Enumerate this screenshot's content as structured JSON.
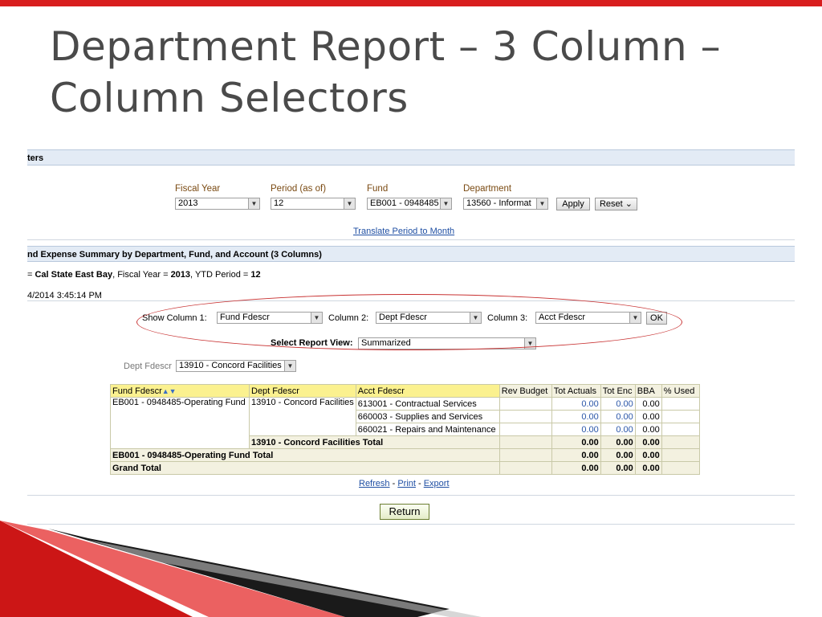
{
  "slide": {
    "title_line1": "Department Report – 3 Column –",
    "title_line2": "Column Selectors"
  },
  "filters": {
    "header": "ters",
    "fiscal_year_label": "Fiscal Year",
    "fiscal_year_value": "2013",
    "period_label": "Period (as of)",
    "period_value": "12",
    "fund_label": "Fund",
    "fund_value": "EB001 - 0948485",
    "department_label": "Department",
    "department_value": "13560 - Informat",
    "apply": "Apply",
    "reset": "Reset",
    "translate_link": "Translate Period to Month"
  },
  "report": {
    "header": "nd Expense Summary by Department, Fund, and Account (3 Columns)",
    "line1_prefix": "= ",
    "campus": "Cal State East Bay",
    "fy_label": ", Fiscal Year = ",
    "fy": "2013",
    "ytd_label": ", YTD Period = ",
    "ytd": "12",
    "timestamp": "4/2014 3:45:14 PM"
  },
  "selectors": {
    "col1_label": "Show Column 1:",
    "col1_value": "Fund Fdescr",
    "col2_label": "Column 2:",
    "col2_value": "Dept Fdescr",
    "col3_label": "Column 3:",
    "col3_value": "Acct Fdescr",
    "ok": "OK",
    "view_label": "Select Report View:",
    "view_value": "Summarized"
  },
  "dept_filter": {
    "label": "Dept Fdescr",
    "value": "13910 - Concord Facilities"
  },
  "table": {
    "headers": [
      "Fund Fdescr",
      "Dept Fdescr",
      "Acct Fdescr",
      "Rev Budget",
      "Tot Actuals",
      "Tot Enc",
      "BBA",
      "% Used"
    ],
    "fund": "EB001 - 0948485-Operating Fund",
    "dept": "13910 - Concord Facilities",
    "rows": [
      {
        "acct": "613001 - Contractual Services",
        "rev": "",
        "act": "0.00",
        "enc": "0.00",
        "bba": "0.00",
        "used": ""
      },
      {
        "acct": "660003 - Supplies and Services",
        "rev": "",
        "act": "0.00",
        "enc": "0.00",
        "bba": "0.00",
        "used": ""
      },
      {
        "acct": "660021 - Repairs and Maintenance",
        "rev": "",
        "act": "0.00",
        "enc": "0.00",
        "bba": "0.00",
        "used": ""
      }
    ],
    "dept_total_label": "13910 - Concord Facilities Total",
    "dept_total": {
      "act": "0.00",
      "enc": "0.00",
      "bba": "0.00"
    },
    "fund_total_label": "EB001 - 0948485-Operating Fund Total",
    "fund_total": {
      "act": "0.00",
      "enc": "0.00",
      "bba": "0.00"
    },
    "grand_total_label": "Grand Total",
    "grand_total": {
      "act": "0.00",
      "enc": "0.00",
      "bba": "0.00"
    }
  },
  "actions": {
    "refresh": "Refresh",
    "sep1": " - ",
    "print": "Print",
    "sep2": " - ",
    "export": "Export",
    "return": "Return"
  },
  "colors": {
    "accent_red": "#d81e1e",
    "header_yellow": "#fbf18f",
    "link_blue": "#1f4fa3"
  }
}
